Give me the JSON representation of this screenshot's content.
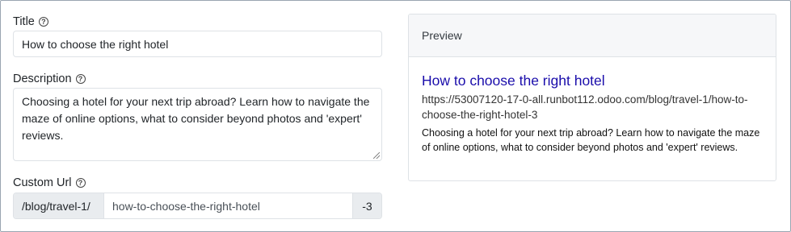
{
  "form": {
    "title": {
      "label": "Title",
      "value": "How to choose the right hotel"
    },
    "description": {
      "label": "Description",
      "value": "Choosing a hotel for your next trip abroad? Learn how to navigate the maze of online options, what to consider beyond photos and 'expert' reviews."
    },
    "custom_url": {
      "label": "Custom Url",
      "prefix": "/blog/travel-1/",
      "value": "how-to-choose-the-right-hotel",
      "suffix": "-3"
    },
    "help_glyph": "?"
  },
  "preview": {
    "header": "Preview",
    "title": "How to choose the right hotel",
    "url": "https://53007120-17-0-all.runbot112.odoo.com/blog/travel-1/how-to-choose-the-right-hotel-3",
    "description": "Choosing a hotel for your next trip abroad? Learn how to navigate the maze of online options, what to consider beyond photos and 'expert' reviews.",
    "title_color": "#1a0dab"
  }
}
